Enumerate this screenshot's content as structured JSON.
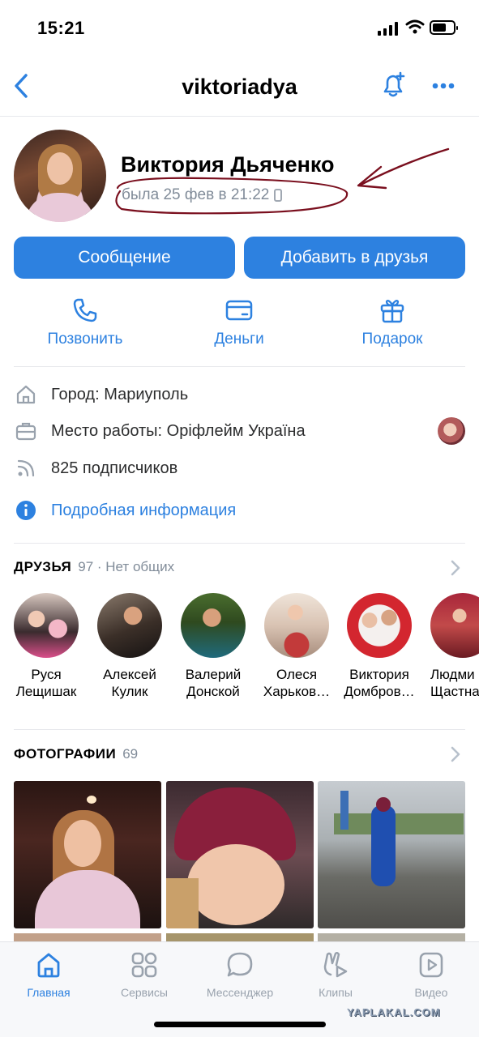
{
  "status_bar": {
    "time": "15:21"
  },
  "nav": {
    "title": "viktoriadya"
  },
  "profile": {
    "name": "Виктория Дьяченко",
    "last_seen": "была 25 фев в 21:22"
  },
  "buttons": {
    "message": "Сообщение",
    "add_friend": "Добавить в друзья"
  },
  "actions": [
    {
      "label": "Позвонить",
      "icon": "phone-icon"
    },
    {
      "label": "Деньги",
      "icon": "card-icon"
    },
    {
      "label": "Подарок",
      "icon": "gift-icon"
    }
  ],
  "info": {
    "city": "Город: Мариуполь",
    "work": "Место работы: Оріфлейм Україна",
    "followers": "825 подписчиков",
    "details": "Подробная информация"
  },
  "friends": {
    "title": "ДРУЗЬЯ",
    "count": "97 · Нет общих",
    "items": [
      {
        "first": "Руся",
        "last": "Лещишак"
      },
      {
        "first": "Алексей",
        "last": "Кулик"
      },
      {
        "first": "Валерий",
        "last": "Донской"
      },
      {
        "first": "Олеся",
        "last": "Харьков…"
      },
      {
        "first": "Виктория",
        "last": "Домбров…"
      },
      {
        "first": "Людми",
        "last": "Щастна"
      }
    ]
  },
  "photos": {
    "title": "ФОТОГРАФИИ",
    "count": "69"
  },
  "tabbar": [
    {
      "label": "Главная",
      "icon": "home-icon",
      "active": true
    },
    {
      "label": "Сервисы",
      "icon": "services-icon",
      "active": false
    },
    {
      "label": "Мессенджер",
      "icon": "messenger-icon",
      "active": false
    },
    {
      "label": "Клипы",
      "icon": "clips-icon",
      "active": false
    },
    {
      "label": "Видео",
      "icon": "video-icon",
      "active": false
    }
  ],
  "watermark": "YAPLAKAL.COM",
  "colors": {
    "accent": "#2d81e0",
    "secondary_text": "#818c99",
    "annotation": "#7a0f1e"
  }
}
